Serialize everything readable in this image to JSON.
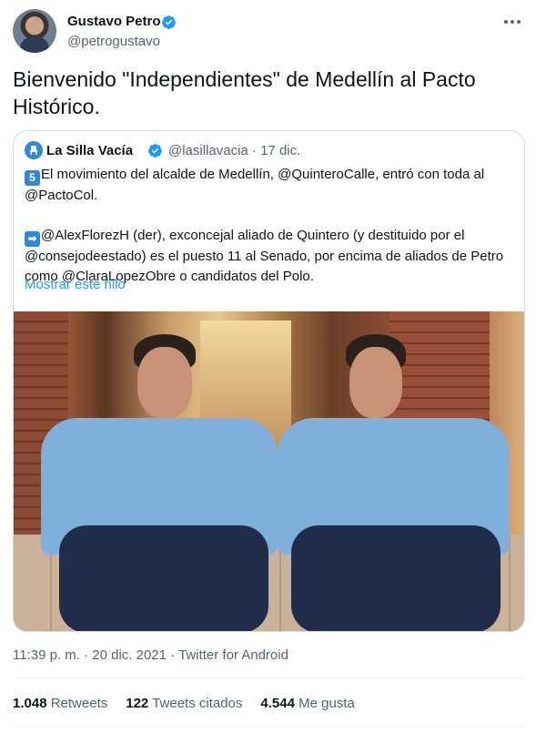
{
  "author": {
    "name": "Gustavo Petro",
    "handle": "@petrogustavo",
    "verified_color": "#1d9bf0"
  },
  "tweet": {
    "text": "Bienvenido \"Independientes\" de Medellín al Pacto Histórico."
  },
  "quoted_tweet": {
    "name": "La Silla Vacía",
    "handle_date": "@lasillavacia · 17 dic.",
    "line1_emoji": "5",
    "line1": "El movimiento del alcalde de Medellín, @QuinteroCalle, entró con toda al",
    "line2": "@PactoCol.",
    "line3_emoji": "➡",
    "line3": "@AlexFlorezH (der), exconcejal aliado de Quintero (y destituido por el",
    "line4": "@consejodeestado) es el puesto 11 al Senado, por encima de aliados de Petro",
    "line5": "como @ClaraLopezObre o candidatos del Polo.",
    "show_thread": "Mostrar este hilo"
  },
  "meta": {
    "time_date": "11:39 p. m. · 20 dic. 2021 · ",
    "source": "Twitter for Android"
  },
  "stats": {
    "retweets_count": "1.048",
    "retweets_label": "Retweets",
    "quotes_count": "122",
    "quotes_label": "Tweets citados",
    "likes_count": "4.544",
    "likes_label": "Me gusta"
  },
  "colors": {
    "link": "#1d9bf0",
    "secondary_text": "#536471",
    "border": "#cfd9de"
  }
}
